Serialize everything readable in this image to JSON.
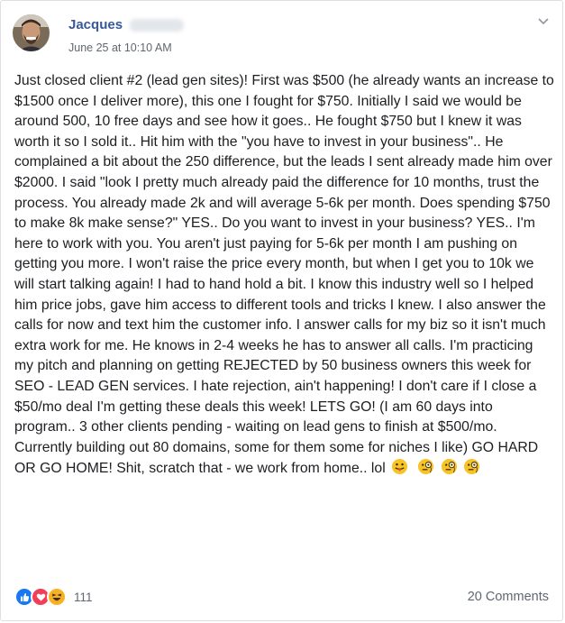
{
  "post": {
    "author": "Jacques",
    "date": "June 25 at 10:10 AM",
    "body": "Just closed client #2 (lead gen sites)! First was $500 (he already wants an increase to $1500 once I deliver more), this one I fought for $750. Initially I said we would be around 500, 10 free days and see how it goes.. He fought $750 but I knew it was worth it so I sold it.. Hit him with the \"you have to invest in your business\".. He complained a bit about the 250 difference, but the leads I sent already made him over $2000. I said \"look I pretty much already paid the difference for 10 months, trust the process. You already made 2k and will average 5-6k per month. Does spending $750 to make 8k make sense?\" YES.. Do you want to invest in your business? YES.. I'm here to work with you. You aren't just paying for 5-6k per month I am pushing on getting you more. I won't raise the price every month, but when I get you to 10k we will start talking again! I had to hand hold a bit. I know this industry well so I helped him price jobs, gave him access to different tools and tricks I knew. I also answer the calls for now and text him the customer info. I answer calls for my biz so it isn't much extra work for me. He knows in 2-4 weeks he has to answer all calls. I'm practicing my pitch and planning on getting REJECTED by 50 business owners this week for SEO - LEAD GEN services. I hate rejection, ain't happening! I don't care if I close a $50/mo deal I'm getting these deals this week! LETS GO! (I am 60 days into program.. 3 other clients pending - waiting on lead gens to finish at $500/mo. Currently building out 80 domains, some for them some for niches I like) GO HARD OR GO HOME! Shit, scratch that - we work from home.. lol"
  },
  "icons": {
    "menu": "chevron-down-icon",
    "emojis": [
      "tongue-out-emoji-icon",
      "monocle-face-emoji-icon",
      "monocle-face-emoji-icon",
      "monocle-face-emoji-icon"
    ],
    "reactions": [
      "like-reaction-icon",
      "love-reaction-icon",
      "haha-reaction-icon"
    ]
  },
  "footer": {
    "reaction_count": "111",
    "comments": "20 Comments"
  },
  "colors": {
    "author": "#385898",
    "like": "#1877f2",
    "love": "#f33e58",
    "haha": "#f7b125"
  }
}
